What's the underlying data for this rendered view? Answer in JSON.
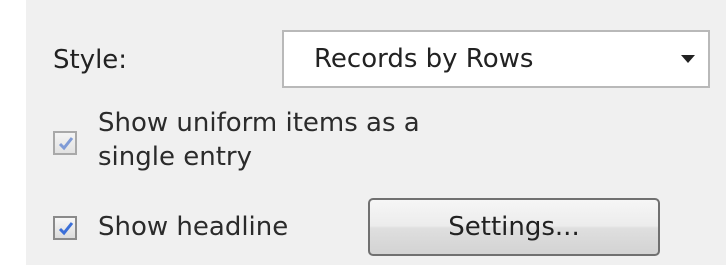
{
  "style": {
    "label": "Style:",
    "selected": "Records by Rows"
  },
  "options": {
    "uniform_line1": "Show uniform items as a",
    "uniform_line2": "single entry",
    "uniform_checked": true,
    "headline_label": "Show headline",
    "headline_checked": true
  },
  "buttons": {
    "settings_label": "Settings..."
  },
  "icons": {
    "dropdown": "chevron-down-icon",
    "check": "checkmark-icon"
  },
  "colors": {
    "panel_bg": "#f0f0f0",
    "checkmark": "#3b6fd8"
  }
}
